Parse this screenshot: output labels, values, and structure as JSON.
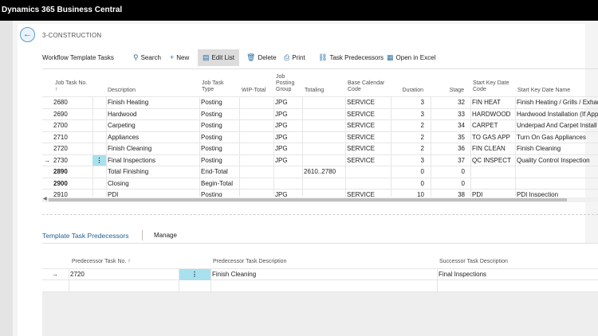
{
  "app": {
    "title": "Dynamics 365 Business Central"
  },
  "nav": {
    "back_icon": "←"
  },
  "breadcrumb": "3-CONSTRUCTION",
  "page_title": "Workflow Template Tasks",
  "actions": {
    "search": "Search",
    "new": "New",
    "edit_list": "Edit List",
    "delete": "Delete",
    "print": "Print",
    "task_predecessors": "Task Predecessors",
    "open_in_excel": "Open in Excel"
  },
  "grid": {
    "headers": {
      "job_task_no": "Job Task No. ↑",
      "description": "Description",
      "job_task_type": "Job Task Type",
      "wip_total": "WIP-Total",
      "job_posting_group": "Job Posting Group",
      "totaling": "Totaling",
      "base_calendar_code": "Base Calendar Code",
      "duration": "Duration",
      "stage": "Stage",
      "start_key_date_code": "Start Key Date Code",
      "start_key_date_name": "Start Key Date Name"
    },
    "rows": [
      {
        "no": "2680",
        "desc": "Finish Heating",
        "type": "Posting",
        "wip": "",
        "jpg": "JPG",
        "tot": "",
        "cal": "SERVICE",
        "dur": "3",
        "stage": "32",
        "skc": "FIN HEAT",
        "skn": "Finish Heating / Grills / Exhaust"
      },
      {
        "no": "2690",
        "desc": "Hardwood",
        "type": "Posting",
        "wip": "",
        "jpg": "JPG",
        "tot": "",
        "cal": "SERVICE",
        "dur": "3",
        "stage": "33",
        "skc": "HARDWOOD",
        "skn": "Hardwood Installation (If Applic"
      },
      {
        "no": "2700",
        "desc": "Carpeting",
        "type": "Posting",
        "wip": "",
        "jpg": "JPG",
        "tot": "",
        "cal": "SERVICE",
        "dur": "2",
        "stage": "34",
        "skc": "CARPET",
        "skn": "Underpad And Carpet Install"
      },
      {
        "no": "2710",
        "desc": "Appliances",
        "type": "Posting",
        "wip": "",
        "jpg": "JPG",
        "tot": "",
        "cal": "SERVICE",
        "dur": "2",
        "stage": "35",
        "skc": "TO GAS APP",
        "skn": "Turn On Gas Appliances"
      },
      {
        "no": "2720",
        "desc": "Finish Cleaning",
        "type": "Posting",
        "wip": "",
        "jpg": "JPG",
        "tot": "",
        "cal": "SERVICE",
        "dur": "2",
        "stage": "36",
        "skc": "FIN CLEAN",
        "skn": "Finish Cleaning"
      },
      {
        "no": "2730",
        "desc": "Final Inspections",
        "type": "Posting",
        "wip": "",
        "jpg": "JPG",
        "tot": "",
        "cal": "SERVICE",
        "dur": "3",
        "stage": "37",
        "skc": "QC INSPECT",
        "skn": "Quality Control Inspection"
      },
      {
        "no": "2890",
        "desc": "Total Finishing",
        "type": "End-Total",
        "wip": "",
        "jpg": "",
        "tot": "2610..2780",
        "cal": "",
        "dur": "0",
        "stage": "0",
        "skc": "",
        "skn": ""
      },
      {
        "no": "2900",
        "desc": "Closing",
        "type": "Begin-Total",
        "wip": "",
        "jpg": "",
        "tot": "",
        "cal": "",
        "dur": "0",
        "stage": "0",
        "skc": "",
        "skn": ""
      },
      {
        "no": "2910",
        "desc": "PDI",
        "type": "Posting",
        "wip": "",
        "jpg": "JPG",
        "tot": "",
        "cal": "SERVICE",
        "dur": "10",
        "stage": "38",
        "skc": "PDI",
        "skn": "PDI Inspection"
      }
    ],
    "current_marker": "→",
    "row_menu_icon": "⋮"
  },
  "subpage": {
    "title": "Template Task Predecessors",
    "manage": "Manage",
    "headers": {
      "pred_no": "Predecessor Task No. ↑",
      "pred_desc": "Predecessor Task Description",
      "succ_desc": "Successor Task Description"
    },
    "rows": [
      {
        "pred_no": "2720",
        "pred_desc": "Finish Cleaning",
        "succ_desc": "Final Inspections"
      }
    ]
  }
}
